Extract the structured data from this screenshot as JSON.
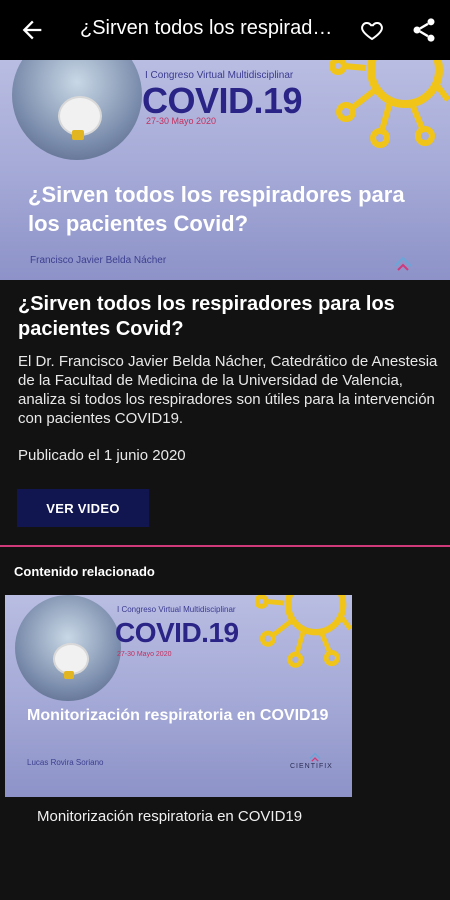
{
  "appbar": {
    "title": "¿Sirven todos los respiradores para los pacientes Covid?"
  },
  "hero": {
    "congress": "I Congreso Virtual Multidisciplinar",
    "brand": "COVID.19",
    "dates": "27-30 Mayo 2020",
    "title": "¿Sirven todos los respiradores para los pacientes Covid?",
    "author": "Francisco Javier Belda Nácher"
  },
  "article": {
    "title": "¿Sirven todos los respiradores para los pacientes Covid?",
    "description": "El Dr. Francisco Javier Belda Nácher, Catedrático de Anestesia de la Facultad de Medicina de la Universidad de Valencia, analiza si todos los respiradores son útiles para la intervención con pacientes COVID19.",
    "published": "Publicado el 1 junio 2020",
    "video_button": "VER VIDEO"
  },
  "related": {
    "heading": "Contenido relacionado",
    "items": [
      {
        "congress": "I Congreso Virtual Multidisciplinar",
        "brand": "COVID.19",
        "dates": "27-30 Mayo 2020",
        "title": "Monitorización respiratoria en COVID19",
        "author": "Lucas Rovira Soriano",
        "logo": "CIENTIFIX",
        "caption": "Monitorización respiratoria en COVID19"
      }
    ]
  },
  "colors": {
    "accent": "#d13a7a",
    "button": "#121650",
    "brand": "#2a2486",
    "virus": "#f0c419"
  },
  "icons": [
    "back-arrow-icon",
    "heart-icon",
    "share-icon",
    "virus-icon",
    "cientifix-logo-icon"
  ]
}
